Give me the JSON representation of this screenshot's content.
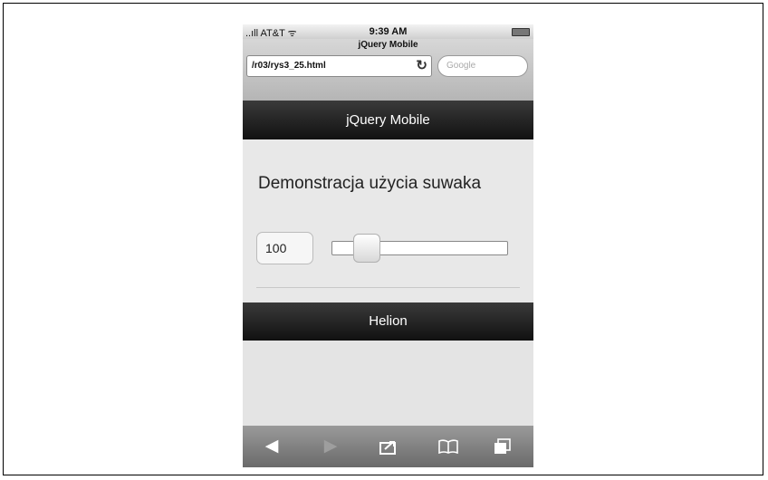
{
  "status_bar": {
    "carrier": "..ıll AT&T ᯤ",
    "time": "9:39 AM"
  },
  "browser": {
    "page_title": "jQuery Mobile",
    "url": "/r03/rys3_25.html",
    "search_placeholder": "Google"
  },
  "header": {
    "title": "jQuery Mobile"
  },
  "content": {
    "heading": "Demonstracja użycia suwaka",
    "slider": {
      "value": "100",
      "min": 0,
      "max": 1000,
      "fraction": 0.1
    }
  },
  "footer": {
    "title": "Helion"
  },
  "icons": {
    "reload": "reload-icon",
    "back": "back-arrow-icon",
    "forward": "forward-arrow-icon",
    "share": "share-icon",
    "bookmarks": "bookmarks-book-icon",
    "pages": "pages-icon"
  },
  "colors": {
    "bar_dark": "#1a1a1a",
    "content_bg": "#e8e8e8",
    "toolbar": "#808080"
  }
}
